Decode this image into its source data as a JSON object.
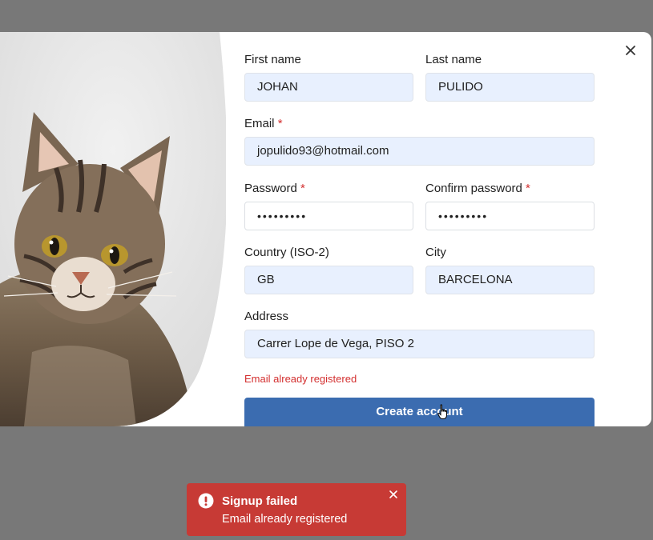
{
  "form": {
    "first_name": {
      "label": "First name",
      "value": "JOHAN"
    },
    "last_name": {
      "label": "Last name",
      "value": "PULIDO"
    },
    "email": {
      "label": "Email",
      "required_mark": "*",
      "value": "jopulido93@hotmail.com"
    },
    "password": {
      "label": "Password",
      "required_mark": "*",
      "value": "•••••••••"
    },
    "confirm_password": {
      "label": "Confirm password",
      "required_mark": "*",
      "value": "•••••••••"
    },
    "country": {
      "label": "Country (ISO-2)",
      "value": "GB"
    },
    "city": {
      "label": "City",
      "value": "BARCELONA"
    },
    "address": {
      "label": "Address",
      "value": "Carrer Lope de Vega, PISO 2"
    },
    "error": "Email already registered",
    "submit_label": "Create account"
  },
  "toast": {
    "title": "Signup failed",
    "message": "Email already registered",
    "icon": "alert-circle-icon"
  },
  "colors": {
    "primary": "#3b6cb0",
    "error": "#d32f2f",
    "toast_bg": "#c73a35",
    "input_bg": "#e8f0fe"
  }
}
